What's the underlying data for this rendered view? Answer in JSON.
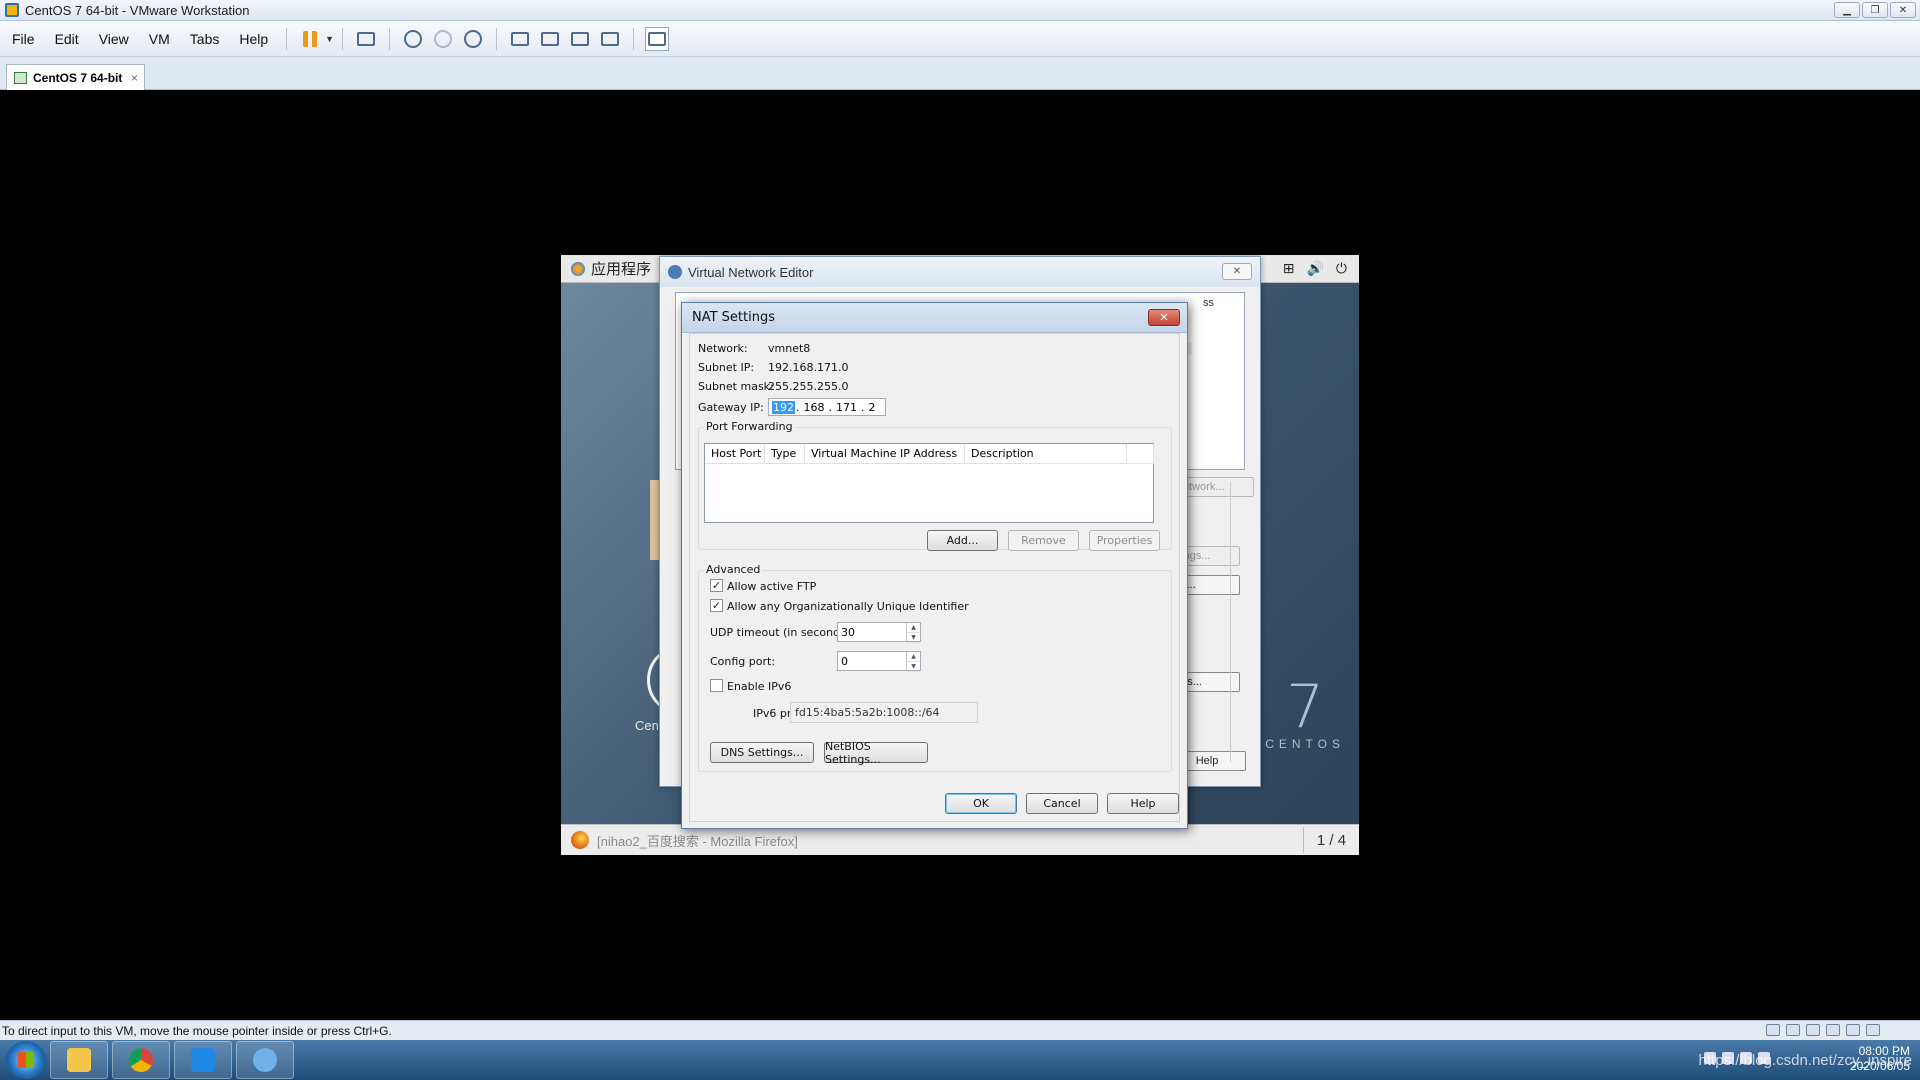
{
  "window": {
    "title": "CentOS 7 64-bit - VMware Workstation",
    "controls": [
      "minimize-icon",
      "restore-icon",
      "close-icon"
    ]
  },
  "menu": {
    "items": [
      "File",
      "Edit",
      "View",
      "VM",
      "Tabs",
      "Help"
    ]
  },
  "toolbar": {
    "icons": [
      "pause-icon",
      "dropdown-icon",
      "send-keys-icon",
      "snapshot-icon",
      "revert-snapshot-icon",
      "snapshot-manager-icon",
      "sidebar-icon",
      "thumbnail-icon",
      "fullscreen-icon",
      "unity-icon",
      "console-view-icon"
    ]
  },
  "tab": {
    "label": "CentOS 7 64-bit",
    "close": "×"
  },
  "guest": {
    "apps_menu": "应用程序",
    "desktop_label": "Cen",
    "brand_number": "7",
    "brand_word": "CENTOS",
    "taskbar_item": "[nihao2_百度搜索 - Mozilla Firefox]",
    "pager": "1 / 4"
  },
  "vne": {
    "title": "Virtual Network Editor",
    "close": "✕",
    "list_header_fragment": "ss",
    "list_cell_fragment": "0",
    "btn_network_fragment": "Network...",
    "btn_settings1_fragment": "ttings...",
    "btn_settings2_fragment": "gs...",
    "btn_settings3_fragment": "ngs...",
    "btn_help": "Help"
  },
  "nat": {
    "title": "NAT Settings",
    "close": "✕",
    "network_label": "Network:",
    "network_value": "vmnet8",
    "subnet_ip_label": "Subnet IP:",
    "subnet_ip_value": "192.168.171.0",
    "subnet_mask_label": "Subnet mask:",
    "subnet_mask_value": "255.255.255.0",
    "gateway_label": "Gateway IP:",
    "gateway": [
      "192",
      "168",
      "171",
      "2"
    ],
    "gateway_dot": ".",
    "port_forwarding": {
      "title": "Port Forwarding",
      "columns": [
        "Host Port",
        "Type",
        "Virtual Machine IP Address",
        "Description"
      ],
      "add": "Add...",
      "remove": "Remove",
      "properties": "Properties"
    },
    "advanced": {
      "title": "Advanced",
      "allow_ftp_label": "Allow active FTP",
      "allow_oui_label": "Allow any Organizationally Unique Identifier",
      "udp_timeout_label": "UDP timeout (in seconds):",
      "udp_timeout_value": "30",
      "config_port_label": "Config port:",
      "config_port_value": "0",
      "enable_ipv6_label": "Enable IPv6",
      "ipv6_prefix_label": "IPv6 prefix:",
      "ipv6_prefix_value": "fd15:4ba5:5a2b:1008::/64",
      "check_mark": "✓",
      "allow_ftp_checked": true,
      "allow_oui_checked": true,
      "enable_ipv6_checked": false
    },
    "dns_settings": "DNS Settings...",
    "netbios_settings": "NetBIOS Settings...",
    "ok": "OK",
    "cancel": "Cancel",
    "help": "Help"
  },
  "statusbar": {
    "text": "To direct input to this VM, move the mouse pointer inside or press Ctrl+G."
  },
  "taskbar": {
    "time": "08:00 PM",
    "date": "2020/06/05",
    "watermark": "https://blog.csdn.net/zcy_inspire"
  }
}
